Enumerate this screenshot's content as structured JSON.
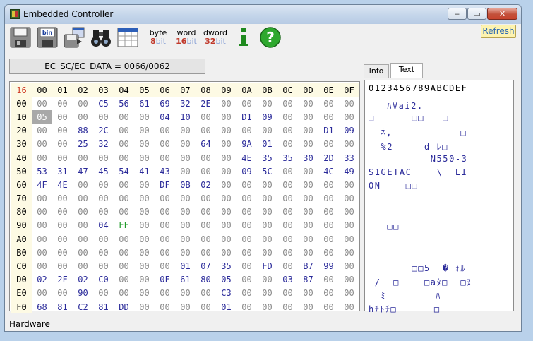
{
  "window": {
    "title": "Embedded Controller",
    "minimize_glyph": "‒",
    "maximize_glyph": "▭",
    "close_glyph": "✕"
  },
  "toolbar": {
    "byte": {
      "top": "byte",
      "num": "8",
      "unit": "bit",
      "num_color": "#c0392b"
    },
    "word": {
      "top": "word",
      "num": "16",
      "unit": "bit",
      "num_color": "#c0392b"
    },
    "dword": {
      "top": "dword",
      "num": "32",
      "unit": "bit",
      "num_color": "#c0392b"
    },
    "info_glyph": "i",
    "help_glyph": "?",
    "refresh_label": "Refresh"
  },
  "address_label": "EC_SC/EC_DATA = 0066/0062",
  "tabs": [
    {
      "label": "Info",
      "active": false
    },
    {
      "label": "Text",
      "active": true
    }
  ],
  "hex": {
    "corner": "16",
    "columns": [
      "00",
      "01",
      "02",
      "03",
      "04",
      "05",
      "06",
      "07",
      "08",
      "09",
      "0A",
      "0B",
      "0C",
      "0D",
      "0E",
      "0F"
    ],
    "rows": [
      {
        "label": "00",
        "cells": [
          "00",
          "00",
          "00",
          "C5",
          "56",
          "61",
          "69",
          "32",
          "2E",
          "00",
          "00",
          "00",
          "00",
          "00",
          "00",
          "00"
        ]
      },
      {
        "label": "10",
        "cells": [
          "05",
          "00",
          "00",
          "00",
          "00",
          "00",
          "04",
          "10",
          "00",
          "00",
          "D1",
          "09",
          "00",
          "00",
          "00",
          "00"
        ]
      },
      {
        "label": "20",
        "cells": [
          "00",
          "00",
          "88",
          "2C",
          "00",
          "00",
          "00",
          "00",
          "00",
          "00",
          "00",
          "00",
          "00",
          "00",
          "D1",
          "09"
        ]
      },
      {
        "label": "30",
        "cells": [
          "00",
          "00",
          "25",
          "32",
          "00",
          "00",
          "00",
          "00",
          "64",
          "00",
          "9A",
          "01",
          "00",
          "00",
          "00",
          "00"
        ]
      },
      {
        "label": "40",
        "cells": [
          "00",
          "00",
          "00",
          "00",
          "00",
          "00",
          "00",
          "00",
          "00",
          "00",
          "4E",
          "35",
          "35",
          "30",
          "2D",
          "33"
        ]
      },
      {
        "label": "50",
        "cells": [
          "53",
          "31",
          "47",
          "45",
          "54",
          "41",
          "43",
          "00",
          "00",
          "00",
          "09",
          "5C",
          "00",
          "00",
          "4C",
          "49"
        ]
      },
      {
        "label": "60",
        "cells": [
          "4F",
          "4E",
          "00",
          "00",
          "00",
          "00",
          "DF",
          "0B",
          "02",
          "00",
          "00",
          "00",
          "00",
          "00",
          "00",
          "00"
        ]
      },
      {
        "label": "70",
        "cells": [
          "00",
          "00",
          "00",
          "00",
          "00",
          "00",
          "00",
          "00",
          "00",
          "00",
          "00",
          "00",
          "00",
          "00",
          "00",
          "00"
        ]
      },
      {
        "label": "80",
        "cells": [
          "00",
          "00",
          "00",
          "00",
          "00",
          "00",
          "00",
          "00",
          "00",
          "00",
          "00",
          "00",
          "00",
          "00",
          "00",
          "00"
        ]
      },
      {
        "label": "90",
        "cells": [
          "00",
          "00",
          "00",
          "04",
          "FF",
          "00",
          "00",
          "00",
          "00",
          "00",
          "00",
          "00",
          "00",
          "00",
          "00",
          "00"
        ]
      },
      {
        "label": "A0",
        "cells": [
          "00",
          "00",
          "00",
          "00",
          "00",
          "00",
          "00",
          "00",
          "00",
          "00",
          "00",
          "00",
          "00",
          "00",
          "00",
          "00"
        ]
      },
      {
        "label": "B0",
        "cells": [
          "00",
          "00",
          "00",
          "00",
          "00",
          "00",
          "00",
          "00",
          "00",
          "00",
          "00",
          "00",
          "00",
          "00",
          "00",
          "00"
        ]
      },
      {
        "label": "C0",
        "cells": [
          "00",
          "00",
          "00",
          "00",
          "00",
          "00",
          "00",
          "01",
          "07",
          "35",
          "00",
          "FD",
          "00",
          "B7",
          "99",
          "00"
        ]
      },
      {
        "label": "D0",
        "cells": [
          "02",
          "2F",
          "02",
          "C0",
          "00",
          "00",
          "0F",
          "61",
          "80",
          "05",
          "00",
          "00",
          "03",
          "87",
          "00",
          "00"
        ]
      },
      {
        "label": "E0",
        "cells": [
          "00",
          "00",
          "90",
          "00",
          "00",
          "00",
          "00",
          "00",
          "00",
          "C3",
          "00",
          "00",
          "00",
          "00",
          "00",
          "00"
        ]
      },
      {
        "label": "F0",
        "cells": [
          "68",
          "81",
          "C2",
          "81",
          "DD",
          "00",
          "00",
          "00",
          "00",
          "01",
          "00",
          "00",
          "00",
          "00",
          "00",
          "00"
        ]
      }
    ],
    "selected": {
      "row": "10",
      "col": "00"
    }
  },
  "text_view": {
    "header": "0123456789ABCDEF",
    "lines": [
      "   ﾊVai2.       ",
      "□      □□   □   ",
      "  ﾈ,           □",
      "  %2     d ﾚ□   ",
      "          N550-3",
      "S1GETAC    \\  LI",
      "ON    □□        ",
      "                ",
      "                ",
      "   □□           ",
      "                ",
      "                ",
      "       □□5  � ｫﾙ",
      " /  □    □aﾀ□  □ﾇ",
      "  ﾐ        ﾊ    ",
      "hﾁﾄﾁ□      □    "
    ]
  },
  "status": {
    "text": "Hardware"
  }
}
